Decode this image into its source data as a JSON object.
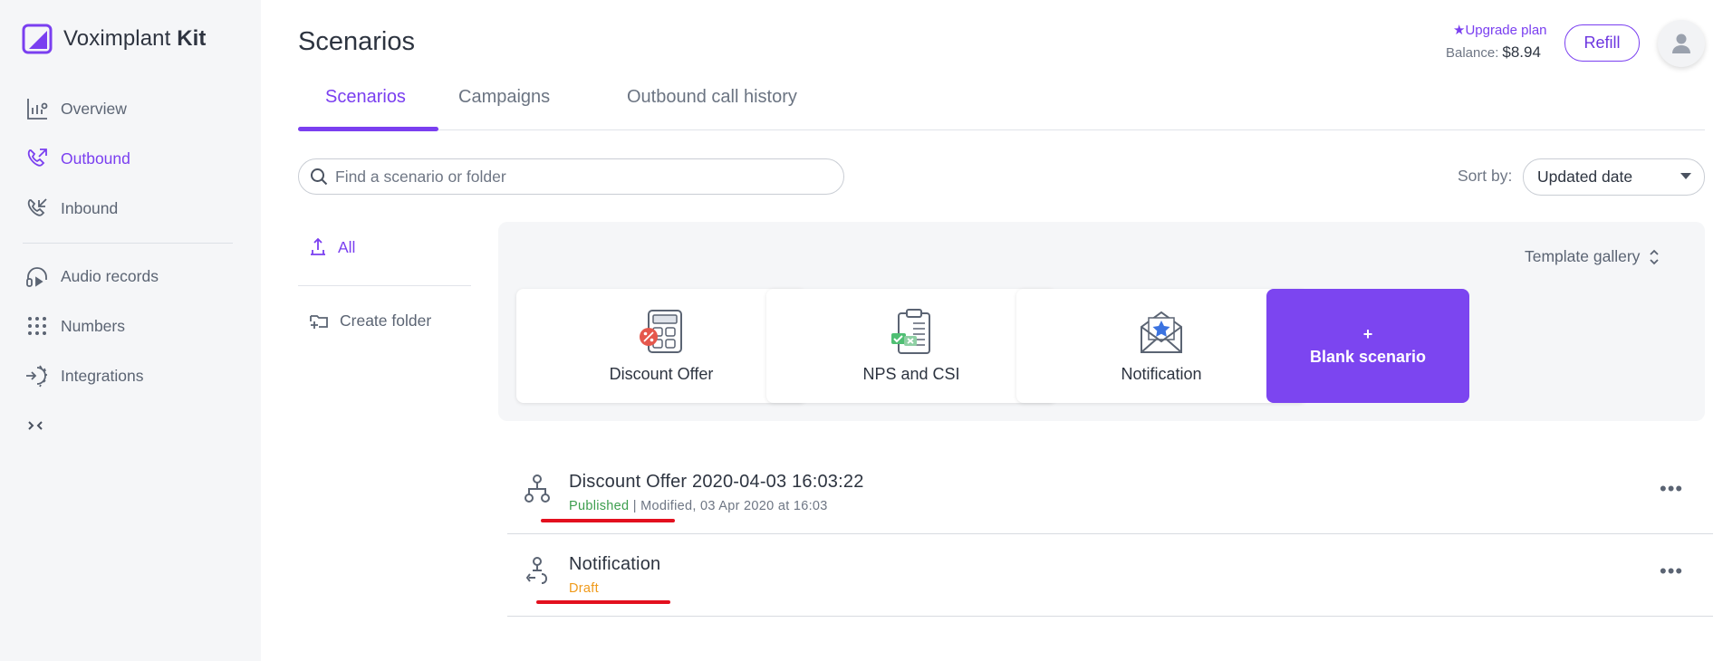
{
  "app": {
    "brand_name": "Voximplant",
    "brand_suffix": "Kit",
    "accent_color": "#7a3ff0"
  },
  "sidebar": {
    "items": [
      {
        "label": "Overview",
        "icon": "chart-icon"
      },
      {
        "label": "Outbound",
        "icon": "outbound-call-icon",
        "active": true
      },
      {
        "label": "Inbound",
        "icon": "inbound-call-icon"
      },
      {
        "label": "Audio records",
        "icon": "headphones-icon"
      },
      {
        "label": "Numbers",
        "icon": "dialpad-icon"
      },
      {
        "label": "Integrations",
        "icon": "integrations-icon"
      }
    ],
    "collapse_icon": "collapse-icon"
  },
  "header": {
    "title": "Scenarios",
    "upgrade_label": "★Upgrade plan",
    "balance_label": "Balance:",
    "balance_value": "$8.94",
    "refill_label": "Refill"
  },
  "tabs": [
    {
      "label": "Scenarios",
      "active": true
    },
    {
      "label": "Campaigns"
    },
    {
      "label": "Outbound call history"
    }
  ],
  "search": {
    "placeholder": "Find a scenario or folder",
    "value": ""
  },
  "sort": {
    "label": "Sort by:",
    "selected": "Updated date"
  },
  "folders": {
    "all_label": "All",
    "create_label": "Create folder"
  },
  "gallery": {
    "toggle_label": "Template gallery",
    "templates": [
      {
        "label": "Discount Offer",
        "icon": "discount-calculator-icon"
      },
      {
        "label": "NPS and CSI",
        "icon": "survey-clipboard-icon"
      },
      {
        "label": "Notification",
        "icon": "envelope-star-icon"
      }
    ],
    "blank": {
      "plus": "+",
      "label": "Blank scenario"
    }
  },
  "scenarios": [
    {
      "title": "Discount Offer 2020-04-03 16:03:22",
      "status": "Published",
      "separator": " | ",
      "modified": "Modified, 03 Apr 2020 at 16:03",
      "status_color": "#3d9e4e"
    },
    {
      "title": "Notification",
      "status": "Draft",
      "status_color": "#f09a1a"
    }
  ],
  "menu_glyph": "•••"
}
